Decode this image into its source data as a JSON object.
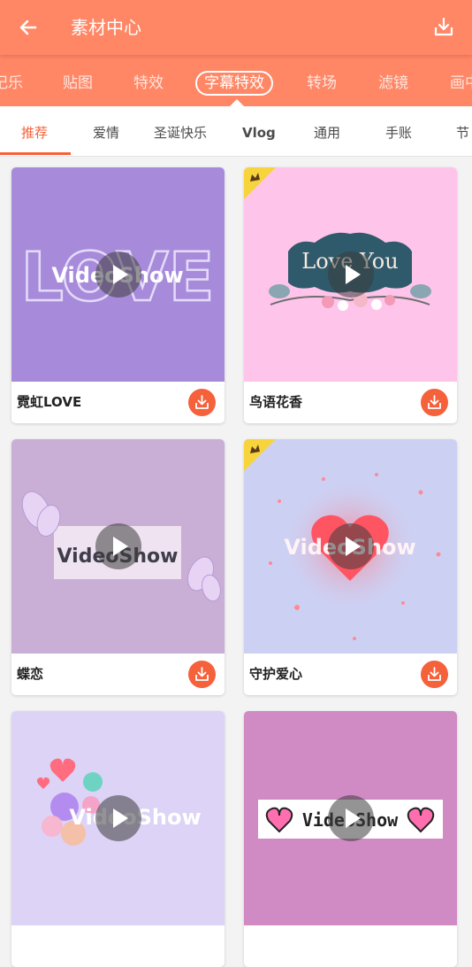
{
  "header": {
    "title": "素材中心",
    "back_icon": "arrow-left-icon",
    "download_icon": "download-tray-icon"
  },
  "categories": {
    "items": [
      "记乐",
      "贴图",
      "特效",
      "字幕特效",
      "转场",
      "滤镜",
      "画中"
    ],
    "active": "字幕特效"
  },
  "subtabs": {
    "items": [
      "推荐",
      "爱情",
      "圣诞快乐",
      "Vlog",
      "通用",
      "手账",
      "节"
    ],
    "active": "推荐"
  },
  "cards": [
    {
      "label": "霓虹LOVE",
      "thumb_text": "VideoShow",
      "bg_text": "LOVE",
      "premium": false,
      "bg_color": "#A78BDA"
    },
    {
      "label": "鸟语花香",
      "thumb_text": "Love You",
      "premium": true,
      "bg_color": "#FFC4E9"
    },
    {
      "label": "蝶恋",
      "thumb_text": "VideoShow",
      "premium": false,
      "bg_color": "#C9AED6"
    },
    {
      "label": "守护爱心",
      "thumb_text": "VideoShow",
      "premium": true,
      "bg_color": "#CCD1F4"
    },
    {
      "label": "",
      "thumb_text": "VideoShow",
      "premium": false,
      "bg_color": "#DCD3F6"
    },
    {
      "label": "",
      "thumb_text": "VideoShow",
      "premium": false,
      "bg_color": "#D08AC4"
    }
  ],
  "colors": {
    "header": "#FF8766",
    "accent": "#F4613A"
  }
}
